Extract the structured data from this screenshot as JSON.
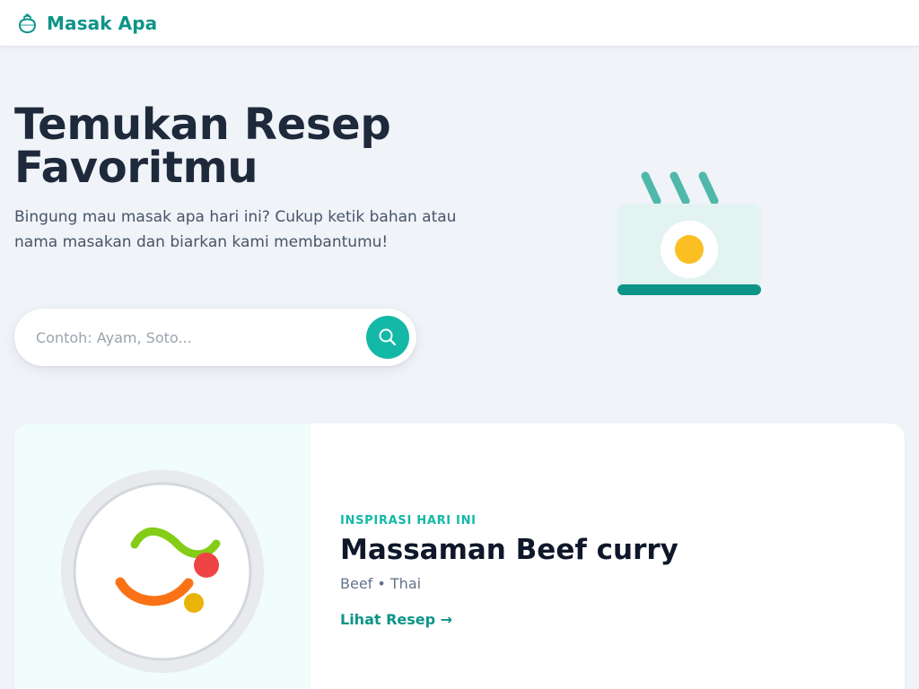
{
  "app": {
    "name": "Masak Apa",
    "logo_icon": "cooking-pot-icon",
    "accent_color": "#0d9488",
    "button_color": "#14b8a6"
  },
  "hero": {
    "title_line1": "Temukan Resep",
    "title_line2": "Favoritmu",
    "description": "Bingung mau masak apa hari ini? Cukup ketik bahan atau nama masakan dan biarkan kami membantumu!",
    "search": {
      "placeholder": "Contoh: Ayam, Soto...",
      "value": "",
      "button_icon": "search-icon"
    },
    "illustration_icon": "steaming-fried-egg-dish-icon"
  },
  "featured": {
    "eyebrow": "INSPIRASI HARI INI",
    "title": "Massaman Beef curry",
    "meta": "Beef • Thai",
    "link_label": "Lihat Resep →",
    "image_icon": "plate-with-food-icon"
  }
}
